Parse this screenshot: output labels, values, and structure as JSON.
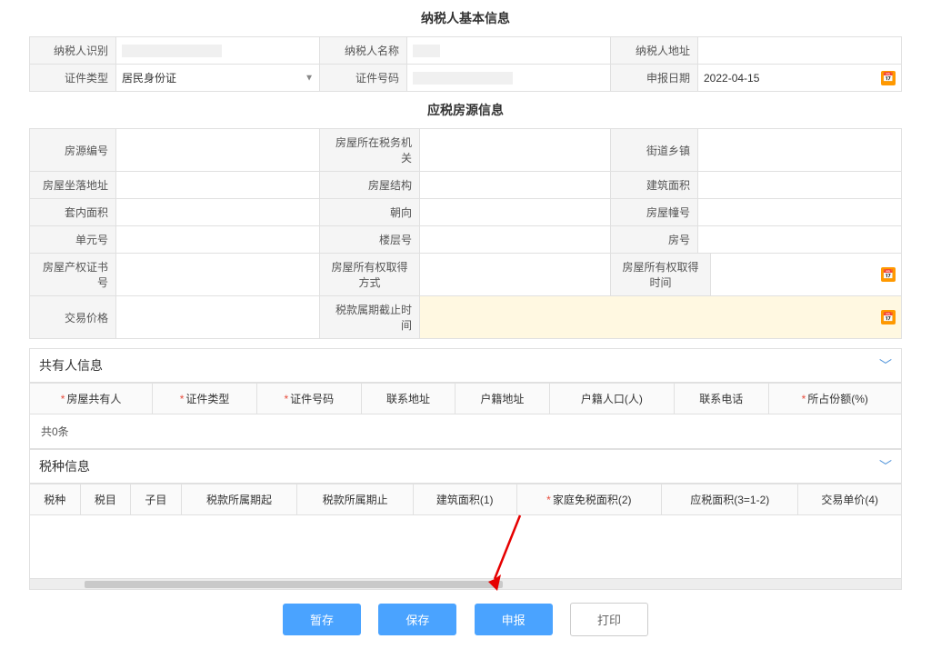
{
  "section_titles": {
    "basic": "纳税人基本信息",
    "house": "应税房源信息"
  },
  "basic": {
    "taxpayer_id_label": "纳税人识别",
    "taxpayer_id_value": "",
    "taxpayer_name_label": "纳税人名称",
    "taxpayer_name_value": "",
    "taxpayer_address_label": "纳税人地址",
    "taxpayer_address_value": "",
    "id_type_label": "证件类型",
    "id_type_value": "居民身份证",
    "id_number_label": "证件号码",
    "id_number_value": "",
    "declare_date_label": "申报日期",
    "declare_date_value": "2022-04-15"
  },
  "house": {
    "source_no_label": "房源编号",
    "tax_org_label": "房屋所在税务机关",
    "town_label": "街道乡镇",
    "location_label": "房屋坐落地址",
    "structure_label": "房屋结构",
    "build_area_label": "建筑面积",
    "inner_area_label": "套内面积",
    "orientation_label": "朝向",
    "block_no_label": "房屋幢号",
    "unit_no_label": "单元号",
    "floor_no_label": "楼层号",
    "room_no_label": "房号",
    "cert_no_label": "房屋产权证书号",
    "acquire_method_label": "房屋所有权取得方式",
    "acquire_time_label": "房屋所有权取得时间",
    "price_label": "交易价格",
    "tax_period_end_label": "税款属期截止时间"
  },
  "coowner": {
    "panel_title": "共有人信息",
    "headers": {
      "owner": "房屋共有人",
      "id_type": "证件类型",
      "id_number": "证件号码",
      "contact_addr": "联系地址",
      "reg_addr": "户籍地址",
      "reg_pop": "户籍人口(人)",
      "phone": "联系电话",
      "share": "所占份额(%)"
    },
    "empty_text": "共0条"
  },
  "taxinfo": {
    "panel_title": "税种信息",
    "headers": {
      "tax_type": "税种",
      "tax_item": "税目",
      "sub_item": "子目",
      "period_start": "税款所属期起",
      "period_end": "税款所属期止",
      "build_area1": "建筑面积(1)",
      "family_exempt2": "家庭免税面积(2)",
      "taxable_area3": "应税面积(3=1-2)",
      "unit_price4": "交易单价(4)"
    }
  },
  "buttons": {
    "temp_save": "暂存",
    "save": "保存",
    "declare": "申报",
    "print": "打印"
  }
}
